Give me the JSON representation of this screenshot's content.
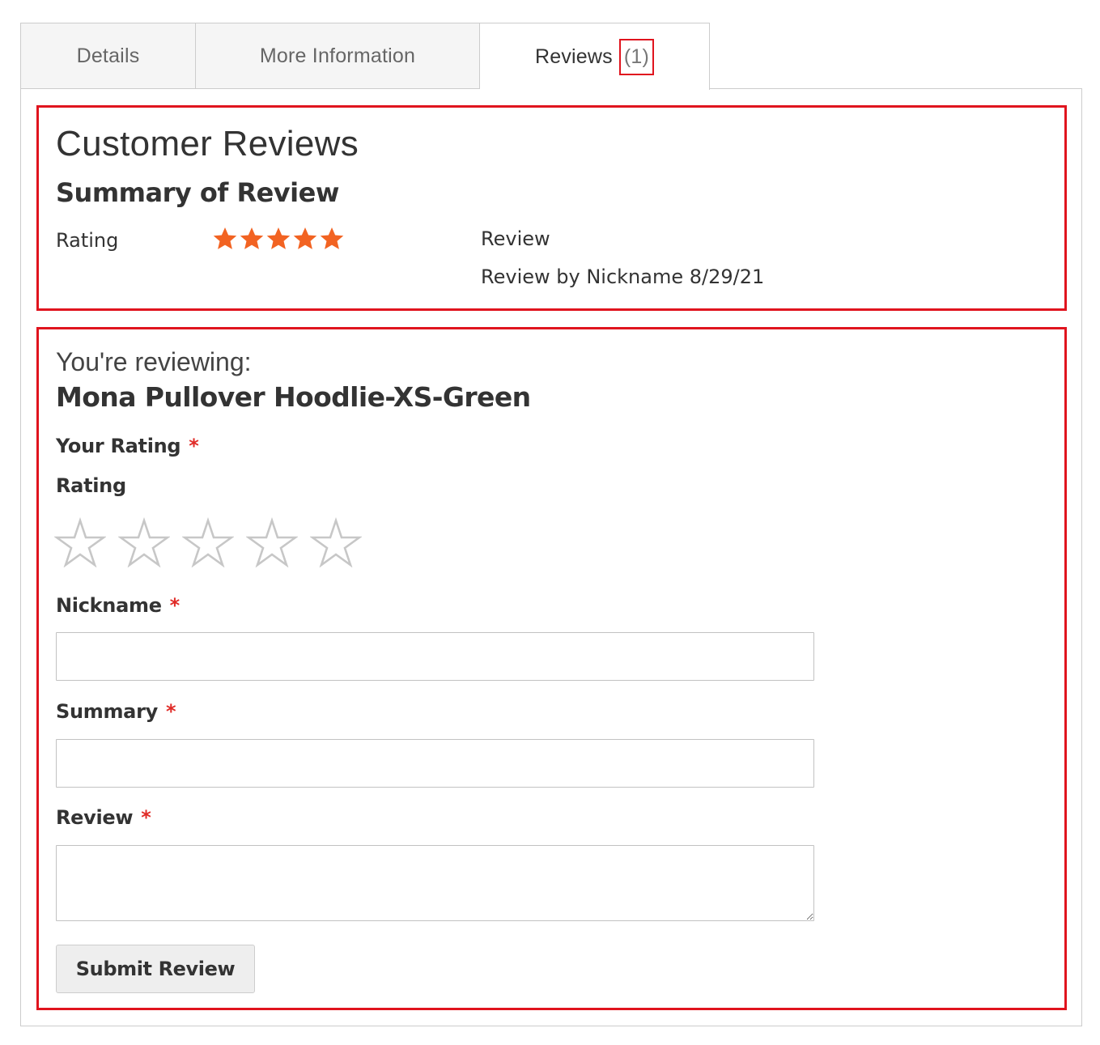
{
  "tabs": [
    {
      "label": "Details",
      "active": false
    },
    {
      "label": "More Information",
      "active": false
    },
    {
      "label": "Reviews",
      "count": "(1)",
      "active": true
    }
  ],
  "customer_reviews": {
    "title": "Customer Reviews",
    "summary_title": "Summary of Review",
    "rating_label": "Rating",
    "rating_value": "5 of 5",
    "star_color": "#f26322",
    "review_title": "Review",
    "review_by": "Review by Nickname 8/29/21"
  },
  "form": {
    "reviewing_label": "You're reviewing:",
    "product_name": "Mona Pullover Hoodlie-XS-Green",
    "your_rating_label": "Your Rating",
    "rating_label": "Rating",
    "rating_selected": "0 of 5",
    "required_marker": "*",
    "nickname_label": "Nickname",
    "nickname_value": "",
    "summary_label": "Summary",
    "summary_value": "",
    "review_label": "Review",
    "review_value": "",
    "submit_label": "Submit Review"
  },
  "colors": {
    "highlight": "#e0141e",
    "required": "#e02b27",
    "star_filled": "#f26322",
    "star_empty": "#c7c7c7"
  }
}
